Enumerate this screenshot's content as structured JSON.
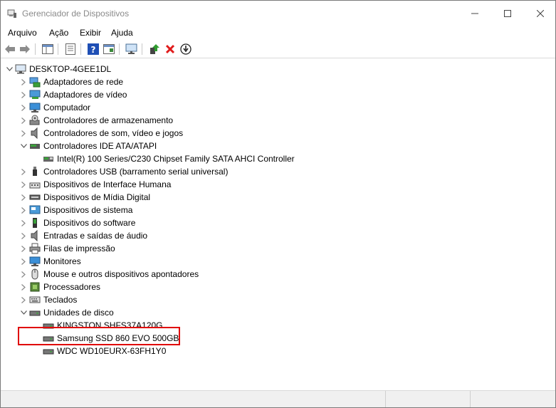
{
  "window": {
    "title": "Gerenciador de Dispositivos"
  },
  "menu": [
    "Arquivo",
    "Ação",
    "Exibir",
    "Ajuda"
  ],
  "tree": {
    "root": "DESKTOP-4GEE1DL",
    "categories": [
      {
        "label": "Adaptadores de rede",
        "icon": "network-adapter-icon",
        "expanded": false
      },
      {
        "label": "Adaptadores de vídeo",
        "icon": "display-adapter-icon",
        "expanded": false
      },
      {
        "label": "Computador",
        "icon": "computer-icon",
        "expanded": false
      },
      {
        "label": "Controladores de armazenamento",
        "icon": "storage-controller-icon",
        "expanded": false
      },
      {
        "label": "Controladores de som, vídeo e jogos",
        "icon": "speaker-icon",
        "expanded": false
      },
      {
        "label": "Controladores IDE ATA/ATAPI",
        "icon": "ide-controller-icon",
        "expanded": true,
        "children": [
          "Intel(R) 100 Series/C230 Chipset Family SATA AHCI Controller"
        ]
      },
      {
        "label": "Controladores USB (barramento serial universal)",
        "icon": "usb-icon",
        "expanded": false
      },
      {
        "label": "Dispositivos de Interface Humana",
        "icon": "hid-icon",
        "expanded": false
      },
      {
        "label": "Dispositivos de Mídia Digital",
        "icon": "digital-media-icon",
        "expanded": false
      },
      {
        "label": "Dispositivos de sistema",
        "icon": "system-device-icon",
        "expanded": false
      },
      {
        "label": "Dispositivos do software",
        "icon": "software-device-icon",
        "expanded": false
      },
      {
        "label": "Entradas e saídas de áudio",
        "icon": "audio-io-icon",
        "expanded": false
      },
      {
        "label": "Filas de impressão",
        "icon": "printer-icon",
        "expanded": false
      },
      {
        "label": "Monitores",
        "icon": "monitor-icon",
        "expanded": false
      },
      {
        "label": "Mouse e outros dispositivos apontadores",
        "icon": "mouse-icon",
        "expanded": false
      },
      {
        "label": "Processadores",
        "icon": "processor-icon",
        "expanded": false
      },
      {
        "label": "Teclados",
        "icon": "keyboard-icon",
        "expanded": false
      },
      {
        "label": "Unidades de disco",
        "icon": "disk-drive-icon",
        "expanded": true,
        "children": [
          "KINGSTON SHFS37A120G",
          "Samsung SSD 860 EVO 500GB",
          "WDC WD10EURX-63FH1Y0"
        ]
      }
    ]
  },
  "highlight_color": "#e00000"
}
